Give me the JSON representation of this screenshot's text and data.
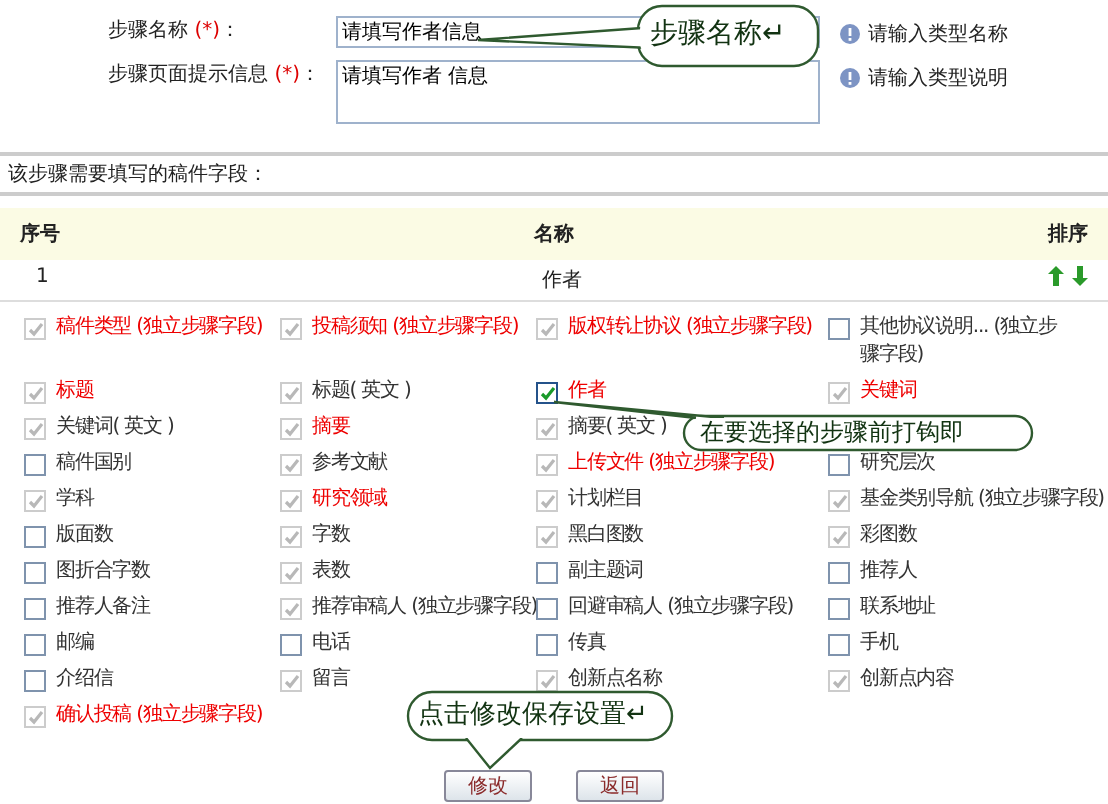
{
  "form": {
    "fields": [
      {
        "kind": "input",
        "label": "步骤名称",
        "required_mark": "(*)",
        "colon": "：",
        "value": "请填写作者信息",
        "hint": "请输入类型名称"
      },
      {
        "kind": "textarea",
        "label": "步骤页面提示信息",
        "required_mark": "(*)",
        "colon": "：",
        "value": "请填写作者 信息",
        "hint": "请输入类型说明"
      }
    ]
  },
  "section_title": "该步骤需要填写的稿件字段：",
  "table": {
    "columns": [
      "序号",
      "名称",
      "排序"
    ],
    "rows": [
      {
        "index": "1",
        "name": "作者"
      }
    ]
  },
  "field_rows": [
    [
      {
        "label": "稿件类型 (独立步骤字段)",
        "checked": true,
        "disabled": true,
        "required": true
      },
      {
        "label": "投稿须知 (独立步骤字段)",
        "checked": true,
        "disabled": true,
        "required": true
      },
      {
        "label": "版权转让协议 (独立步骤字段)",
        "checked": true,
        "disabled": true,
        "required": true
      },
      {
        "label": "其他协议说明... (独立步骤字段)",
        "checked": false,
        "disabled": false,
        "required": false
      }
    ],
    [
      {
        "label": "标题",
        "checked": true,
        "disabled": true,
        "required": true
      },
      {
        "label": "标题( 英文 )",
        "checked": true,
        "disabled": true,
        "required": false
      },
      {
        "label": "作者",
        "checked": true,
        "disabled": false,
        "required": true
      },
      {
        "label": "关键词",
        "checked": true,
        "disabled": true,
        "required": true
      }
    ],
    [
      {
        "label": "关键词( 英文 )",
        "checked": true,
        "disabled": true,
        "required": false
      },
      {
        "label": "摘要",
        "checked": true,
        "disabled": true,
        "required": true
      },
      {
        "label": "摘要( 英文 )",
        "checked": true,
        "disabled": true,
        "required": false
      }
    ],
    [
      {
        "label": "稿件国别",
        "checked": false,
        "disabled": false,
        "required": false
      },
      {
        "label": "参考文献",
        "checked": true,
        "disabled": true,
        "required": false
      },
      {
        "label": "上传文件 (独立步骤字段)",
        "checked": true,
        "disabled": true,
        "required": true
      },
      {
        "label": "研究层次",
        "checked": false,
        "disabled": false,
        "required": false
      }
    ],
    [
      {
        "label": "学科",
        "checked": true,
        "disabled": true,
        "required": false
      },
      {
        "label": "研究领域",
        "checked": true,
        "disabled": true,
        "required": true
      },
      {
        "label": "计划栏目",
        "checked": true,
        "disabled": true,
        "required": false
      },
      {
        "label": "基金类别导航 (独立步骤字段)",
        "checked": true,
        "disabled": true,
        "required": false
      }
    ],
    [
      {
        "label": "版面数",
        "checked": false,
        "disabled": false,
        "required": false
      },
      {
        "label": "字数",
        "checked": true,
        "disabled": true,
        "required": false
      },
      {
        "label": "黑白图数",
        "checked": true,
        "disabled": true,
        "required": false
      },
      {
        "label": "彩图数",
        "checked": true,
        "disabled": true,
        "required": false
      }
    ],
    [
      {
        "label": "图折合字数",
        "checked": false,
        "disabled": false,
        "required": false
      },
      {
        "label": "表数",
        "checked": true,
        "disabled": true,
        "required": false
      },
      {
        "label": "副主题词",
        "checked": false,
        "disabled": false,
        "required": false
      },
      {
        "label": "推荐人",
        "checked": false,
        "disabled": false,
        "required": false
      }
    ],
    [
      {
        "label": "推荐人备注",
        "checked": false,
        "disabled": false,
        "required": false
      },
      {
        "label": "推荐审稿人 (独立步骤字段)",
        "checked": true,
        "disabled": true,
        "required": false
      },
      {
        "label": "回避审稿人 (独立步骤字段)",
        "checked": false,
        "disabled": false,
        "required": false
      },
      {
        "label": "联系地址",
        "checked": false,
        "disabled": false,
        "required": false
      }
    ],
    [
      {
        "label": "邮编",
        "checked": false,
        "disabled": false,
        "required": false
      },
      {
        "label": "电话",
        "checked": false,
        "disabled": false,
        "required": false
      },
      {
        "label": "传真",
        "checked": false,
        "disabled": false,
        "required": false
      },
      {
        "label": "手机",
        "checked": false,
        "disabled": false,
        "required": false
      }
    ],
    [
      {
        "label": "介绍信",
        "checked": false,
        "disabled": false,
        "required": false
      },
      {
        "label": "留言",
        "checked": true,
        "disabled": true,
        "required": false
      },
      {
        "label": "创新点名称",
        "checked": true,
        "disabled": true,
        "required": false
      },
      {
        "label": "创新点内容",
        "checked": true,
        "disabled": true,
        "required": false
      }
    ],
    [
      {
        "label": "确认投稿 (独立步骤字段)",
        "checked": true,
        "disabled": true,
        "required": true
      }
    ]
  ],
  "buttons": [
    "修改",
    "返回"
  ],
  "callouts": [
    {
      "text": "步骤名称↵"
    },
    {
      "text": "在要选择的步骤前打钩即"
    },
    {
      "text": "点击修改保存设置↵"
    }
  ]
}
